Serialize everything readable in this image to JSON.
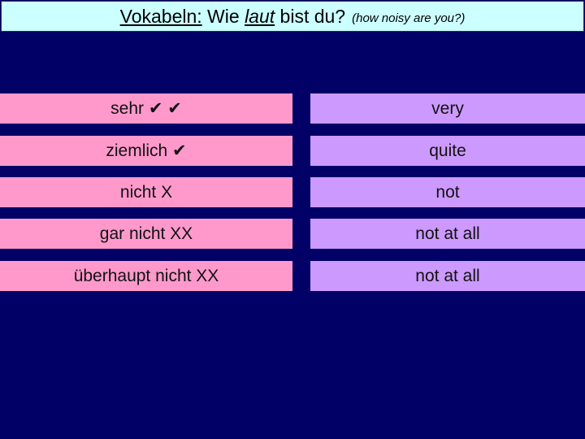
{
  "title": {
    "part1": "Vokabeln:",
    "part2": " Wie ",
    "part3": "laut",
    "part4": " bist du?",
    "subtitle": "(how noisy are you?)"
  },
  "colors": {
    "background": "#000066",
    "title_bg": "#ccffff",
    "german_bg": "#ff99cc",
    "english_bg": "#cc99ff"
  },
  "vocab": [
    {
      "german": "sehr ✔ ✔",
      "english": "very"
    },
    {
      "german": "ziemlich ✔",
      "english": "quite"
    },
    {
      "german": "nicht X",
      "english": "not"
    },
    {
      "german": "gar nicht XX",
      "english": "not at all"
    },
    {
      "german": "überhaupt nicht XX",
      "english": "not at all"
    }
  ]
}
